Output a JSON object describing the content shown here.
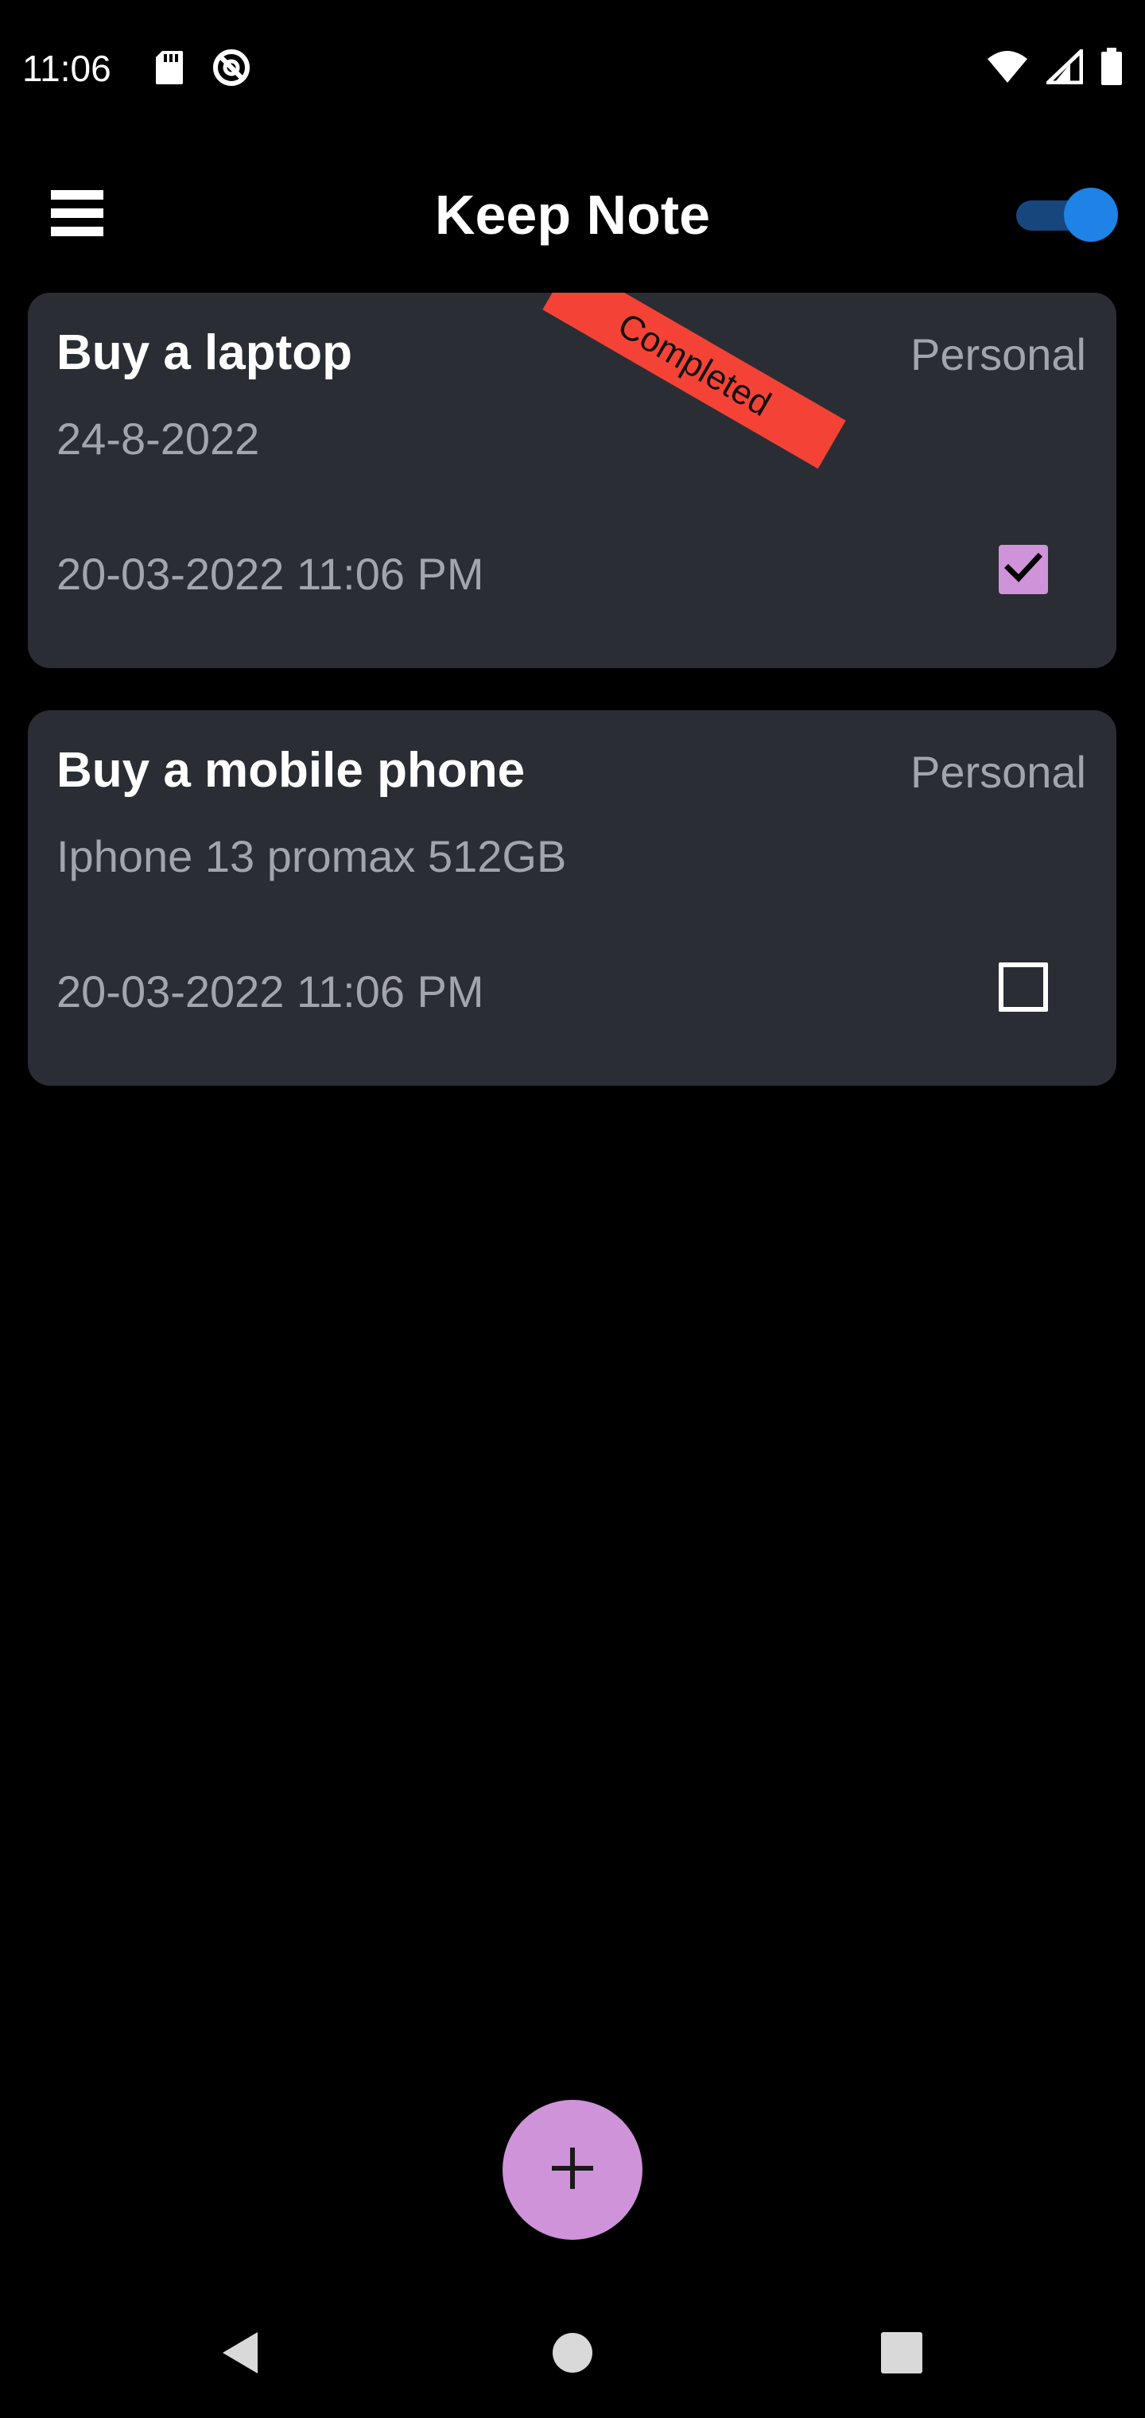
{
  "status_bar": {
    "time": "11:06",
    "left_icons": [
      "sd-card-icon",
      "do-not-disturb-icon"
    ],
    "right_icons": [
      "wifi-icon",
      "cell-signal-icon",
      "battery-icon"
    ]
  },
  "app_bar": {
    "title": "Keep Note",
    "menu_icon": "menu-icon",
    "theme_toggle_on": true
  },
  "notes": [
    {
      "title": "Buy a laptop",
      "category": "Personal",
      "description": "24-8-2022",
      "date": "20-03-2022 11:06 PM",
      "completed": true,
      "ribbon": "Completed"
    },
    {
      "title": "Buy a mobile phone",
      "category": "Personal",
      "description": "Iphone 13 promax 512GB",
      "date": "20-03-2022 11:06 PM",
      "completed": false
    }
  ],
  "fab": {
    "icon": "plus-icon"
  },
  "nav_bar": {
    "icons": [
      "back-icon",
      "home-icon",
      "recents-icon"
    ]
  },
  "colors": {
    "background": "#000000",
    "card": "#2b2d35",
    "secondary_text": "#a3a5ab",
    "accent": "#cf93d9",
    "ribbon": "#f44336",
    "toggle_thumb": "#1e82e6",
    "toggle_track": "#16467c"
  }
}
